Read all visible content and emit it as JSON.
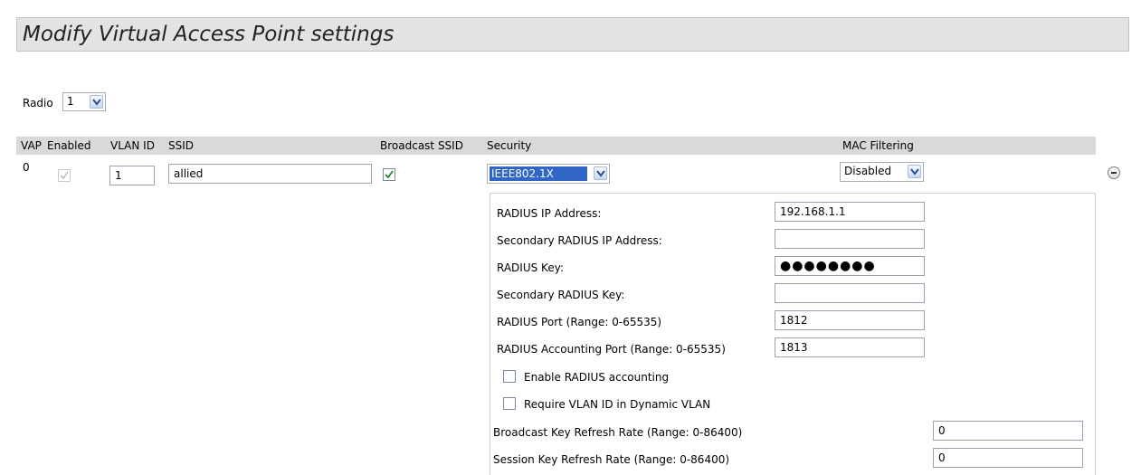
{
  "page": {
    "title": "Modify Virtual Access Point settings"
  },
  "radio": {
    "label": "Radio",
    "value": "1"
  },
  "table": {
    "headers": {
      "vap": "VAP",
      "enabled": "Enabled",
      "vlan_id": "VLAN ID",
      "ssid": "SSID",
      "broadcast_ssid": "Broadcast SSID",
      "security": "Security",
      "mac_filtering": "MAC Filtering"
    },
    "row": {
      "vap": "0",
      "enabled": true,
      "vlan_id": "1",
      "ssid": "allied",
      "broadcast_ssid": true,
      "security": "IEEE802.1X",
      "mac_filtering": "Disabled"
    }
  },
  "radius": {
    "ip_label": "RADIUS IP Address:",
    "ip_value": "192.168.1.1",
    "secondary_ip_label": "Secondary RADIUS IP Address:",
    "secondary_ip_value": "",
    "key_label": "RADIUS Key:",
    "key_value": "●●●●●●●●",
    "secondary_key_label": "Secondary RADIUS Key:",
    "secondary_key_value": "",
    "port_label": "RADIUS Port (Range: 0-65535)",
    "port_value": "1812",
    "acct_port_label": "RADIUS Accounting Port (Range: 0-65535)",
    "acct_port_value": "1813",
    "enable_accounting_label": "Enable RADIUS accounting",
    "enable_accounting_checked": false,
    "require_vlan_label": "Require VLAN ID in Dynamic VLAN",
    "require_vlan_checked": false,
    "broadcast_refresh_label": "Broadcast Key Refresh Rate (Range: 0-86400)",
    "broadcast_refresh_value": "0",
    "session_refresh_label": "Session Key Refresh Rate (Range: 0-86400)",
    "session_refresh_value": "0"
  },
  "icons": {
    "dropdown": "chevron-down-icon",
    "check": "check-icon",
    "collapse": "minus-circle-icon"
  },
  "colors": {
    "security_highlight": "#3165c6",
    "header_bg": "#d9d9d9",
    "title_bg": "#e3e3e3",
    "check_color": "#1e8a2a"
  }
}
